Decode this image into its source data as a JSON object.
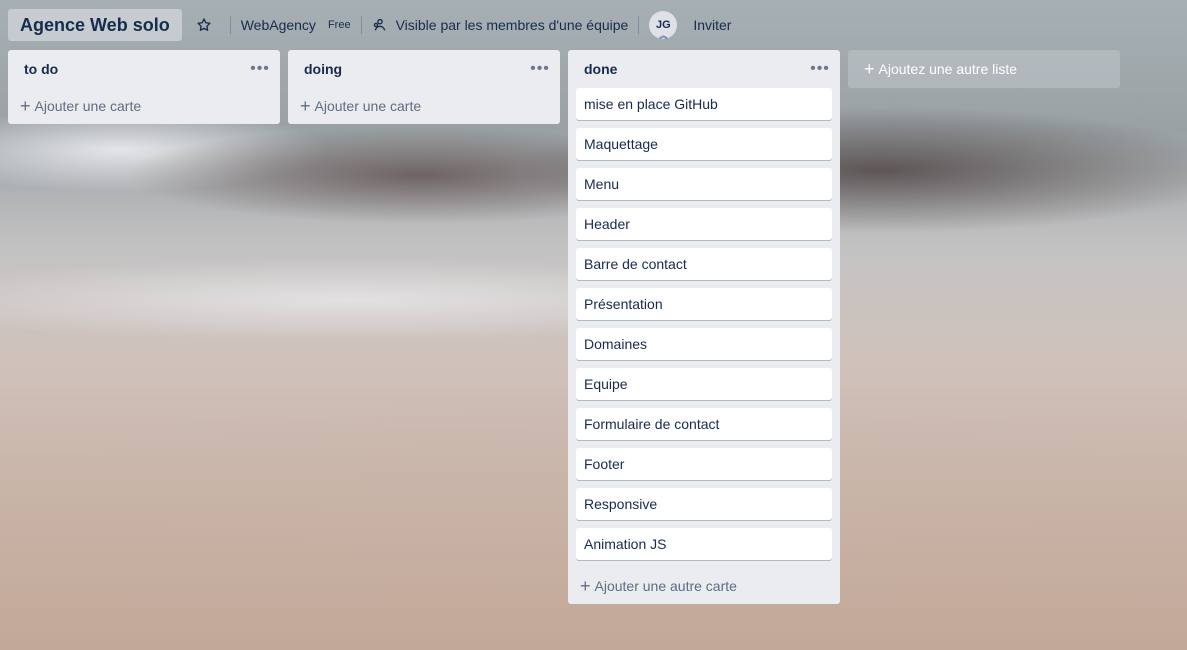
{
  "header": {
    "board_title": "Agence Web solo",
    "team_name": "WebAgency",
    "team_plan": "Free",
    "visibility": "Visible par les membres d'une équipe",
    "avatar_initials": "JG",
    "invite_label": "Inviter"
  },
  "lists": [
    {
      "title": "to do",
      "cards": [],
      "add_card_label": "Ajouter une carte"
    },
    {
      "title": "doing",
      "cards": [],
      "add_card_label": "Ajouter une carte"
    },
    {
      "title": "done",
      "cards": [
        "mise en place GitHub",
        "Maquettage",
        "Menu",
        "Header",
        "Barre de contact",
        "Présentation",
        "Domaines",
        "Equipe",
        "Formulaire de contact",
        "Footer",
        "Responsive",
        "Animation JS"
      ],
      "add_card_label": "Ajouter une autre carte"
    }
  ],
  "add_list_label": "Ajoutez une autre liste",
  "icons": {
    "star": "star-icon",
    "visibility": "team-visibility-icon",
    "list_menu": "more-horizontal-icon",
    "add": "plus-icon"
  },
  "colors": {
    "list_bg": "#ebecf0",
    "card_bg": "#ffffff",
    "text": "#172b4d",
    "muted": "#5e6c84"
  }
}
